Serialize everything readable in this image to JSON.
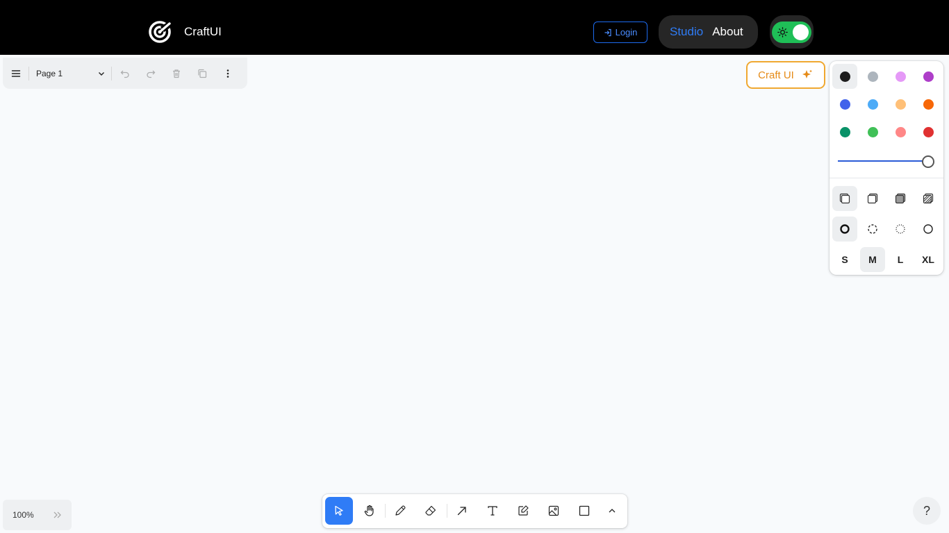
{
  "header": {
    "brand": "CraftUI",
    "login_label": "Login",
    "nav": [
      {
        "label": "Studio",
        "active": true
      },
      {
        "label": "About",
        "active": false
      }
    ],
    "theme_toggle_on": true,
    "colors": {
      "background": "#000000",
      "accent": "#2f7cf6",
      "toggle": "#1fbf57"
    }
  },
  "menu_panel": {
    "page_name": "Page 1",
    "icons": [
      "hamburger-menu-icon",
      "chevron-down-icon",
      "undo-icon",
      "redo-icon",
      "trash-icon",
      "duplicate-icon",
      "more-vertical-icon"
    ]
  },
  "craft_button": {
    "label": "Craft UI",
    "icon": "sparkle-icon",
    "color": "#e58a16"
  },
  "style_panel": {
    "colors": [
      {
        "name": "black",
        "hex": "#1d1d1d",
        "selected": true
      },
      {
        "name": "grey",
        "hex": "#adb5bd"
      },
      {
        "name": "light-violet",
        "hex": "#e599f7"
      },
      {
        "name": "violet",
        "hex": "#ae3ec9"
      },
      {
        "name": "blue",
        "hex": "#4263eb"
      },
      {
        "name": "light-blue",
        "hex": "#4dabf7"
      },
      {
        "name": "yellow",
        "hex": "#ffc078"
      },
      {
        "name": "orange",
        "hex": "#f76707"
      },
      {
        "name": "green",
        "hex": "#099268"
      },
      {
        "name": "light-green",
        "hex": "#40c057"
      },
      {
        "name": "light-red",
        "hex": "#ff8787"
      },
      {
        "name": "red",
        "hex": "#e03131"
      }
    ],
    "opacity": 1.0,
    "fill_styles": [
      "fill-none-icon",
      "fill-semi-icon",
      "fill-solid-icon",
      "fill-pattern-icon"
    ],
    "fill_selected": 0,
    "dash_styles": [
      "dash-draw-icon",
      "dash-dashed-icon",
      "dash-dotted-icon",
      "dash-solid-icon"
    ],
    "dash_selected": 0,
    "sizes": [
      "S",
      "M",
      "L",
      "XL"
    ],
    "size_selected": 1
  },
  "zoom": {
    "label": "100%"
  },
  "tools": [
    {
      "name": "select-tool",
      "icon": "cursor-icon",
      "active": true
    },
    {
      "name": "hand-tool",
      "icon": "hand-icon"
    },
    {
      "name": "draw-tool",
      "icon": "pencil-icon"
    },
    {
      "name": "eraser-tool",
      "icon": "eraser-icon"
    },
    {
      "name": "arrow-tool",
      "icon": "arrow-icon"
    },
    {
      "name": "text-tool",
      "icon": "text-icon"
    },
    {
      "name": "note-tool",
      "icon": "note-icon"
    },
    {
      "name": "image-tool",
      "icon": "image-icon"
    },
    {
      "name": "rectangle-tool",
      "icon": "rectangle-icon"
    },
    {
      "name": "more-tools",
      "icon": "chevron-up-icon"
    }
  ],
  "help": {
    "label": "?"
  }
}
